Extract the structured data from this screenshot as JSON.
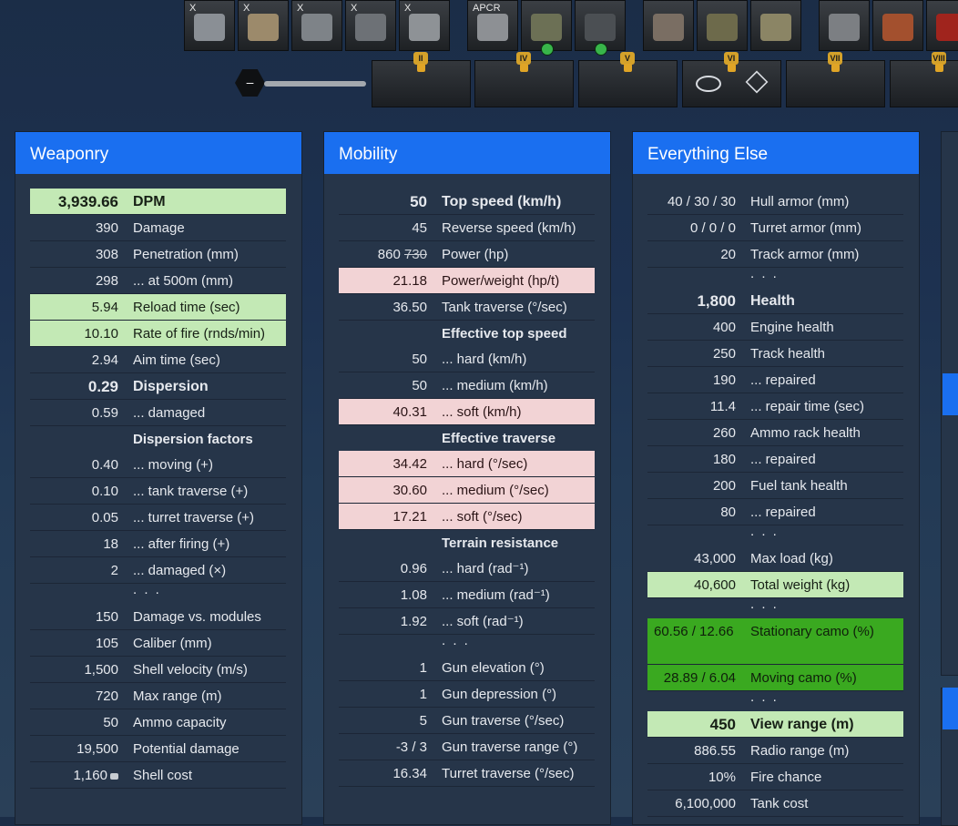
{
  "modules_top": [
    {
      "label": "X",
      "icon": "gun-module-icon",
      "color": "#8a8f95"
    },
    {
      "label": "X",
      "icon": "turret-module-icon",
      "color": "#9c8a6b"
    },
    {
      "label": "X",
      "icon": "engine-module-icon",
      "color": "#7e8388"
    },
    {
      "label": "X",
      "icon": "tracks-module-icon",
      "color": "#6d7176"
    },
    {
      "label": "X",
      "icon": "radio-module-icon",
      "color": "#8e9296"
    },
    {
      "label": "APCR",
      "icon": "shell-icon",
      "color": "#8d9094"
    },
    {
      "label": "",
      "icon": "ammo-box-icon",
      "color": "#6c7055"
    },
    {
      "label": "",
      "icon": "tank-badge-icon",
      "color": "#4b4f53"
    },
    {
      "label": "",
      "icon": "rammer-icon",
      "color": "#7a6e63"
    },
    {
      "label": "",
      "icon": "camo-net-icon",
      "color": "#6d6a4b"
    },
    {
      "label": "",
      "icon": "vent-icon",
      "color": "#8b8565"
    },
    {
      "label": "",
      "icon": "wheels-icon",
      "color": "#7c7f83"
    },
    {
      "label": "",
      "icon": "medkit-icon",
      "color": "#a3502e"
    },
    {
      "label": "",
      "icon": "extra-slot-icon",
      "color": "#a0241d"
    }
  ],
  "tiers": [
    "II",
    "IV",
    "V",
    "VI",
    "VII",
    "VIII"
  ],
  "slider": {
    "knob_label": "–"
  },
  "weaponry": {
    "title": "Weaponry",
    "rows": [
      {
        "v": "3,939.66",
        "l": "DPM",
        "style": "bold green"
      },
      {
        "v": "390",
        "l": "Damage"
      },
      {
        "v": "308",
        "l": "Penetration (mm)"
      },
      {
        "v": "298",
        "l": "... at 500m (mm)"
      },
      {
        "v": "5.94",
        "l": "Reload time (sec)",
        "style": "green"
      },
      {
        "v": "10.10",
        "l": "Rate of fire (rnds/min)",
        "style": "green"
      },
      {
        "v": "2.94",
        "l": "Aim time (sec)"
      },
      {
        "v": "0.29",
        "l": "Dispersion",
        "style": "bold"
      },
      {
        "v": "0.59",
        "l": "... damaged"
      },
      {
        "v": "",
        "l": "Dispersion factors",
        "style": "head"
      },
      {
        "v": "0.40",
        "l": "... moving (+)"
      },
      {
        "v": "0.10",
        "l": "... tank traverse (+)"
      },
      {
        "v": "0.05",
        "l": "... turret traverse (+)"
      },
      {
        "v": "18",
        "l": "... after firing (+)"
      },
      {
        "v": "2",
        "l": "... damaged (×)"
      },
      {
        "v": "",
        "l": ". . .",
        "style": "dots"
      },
      {
        "v": "150",
        "l": "Damage vs. modules"
      },
      {
        "v": "105",
        "l": "Caliber (mm)"
      },
      {
        "v": "1,500",
        "l": "Shell velocity (m/s)"
      },
      {
        "v": "720",
        "l": "Max range (m)"
      },
      {
        "v": "50",
        "l": "Ammo capacity"
      },
      {
        "v": "19,500",
        "l": "Potential damage"
      },
      {
        "v": "1,160",
        "l": "Shell cost",
        "style": "coin"
      }
    ]
  },
  "mobility": {
    "title": "Mobility",
    "power_old": "730",
    "rows": [
      {
        "v": "50",
        "l": "Top speed (km/h)",
        "style": "bold"
      },
      {
        "v": "45",
        "l": "Reverse speed (km/h)"
      },
      {
        "v": "860",
        "l": "Power (hp)",
        "style": "strike"
      },
      {
        "v": "21.18",
        "l": "Power/weight (hp/t)",
        "style": "red"
      },
      {
        "v": "36.50",
        "l": "Tank traverse (°/sec)"
      },
      {
        "v": "",
        "l": "Effective top speed",
        "style": "head"
      },
      {
        "v": "50",
        "l": "... hard (km/h)"
      },
      {
        "v": "50",
        "l": "... medium (km/h)"
      },
      {
        "v": "40.31",
        "l": "... soft (km/h)",
        "style": "red"
      },
      {
        "v": "",
        "l": "Effective traverse",
        "style": "head"
      },
      {
        "v": "34.42",
        "l": "... hard (°/sec)",
        "style": "red"
      },
      {
        "v": "30.60",
        "l": "... medium (°/sec)",
        "style": "red"
      },
      {
        "v": "17.21",
        "l": "... soft (°/sec)",
        "style": "red"
      },
      {
        "v": "",
        "l": "Terrain resistance",
        "style": "head"
      },
      {
        "v": "0.96",
        "l": "... hard (rad⁻¹)"
      },
      {
        "v": "1.08",
        "l": "... medium (rad⁻¹)"
      },
      {
        "v": "1.92",
        "l": "... soft (rad⁻¹)"
      },
      {
        "v": "",
        "l": ". . .",
        "style": "dots"
      },
      {
        "v": "1",
        "l": "Gun elevation (°)"
      },
      {
        "v": "1",
        "l": "Gun depression (°)"
      },
      {
        "v": "5",
        "l": "Gun traverse (°/sec)"
      },
      {
        "v": "-3 / 3",
        "l": "Gun traverse range (°)"
      },
      {
        "v": "16.34",
        "l": "Turret traverse (°/sec)"
      }
    ]
  },
  "everything": {
    "title": "Everything Else",
    "rows": [
      {
        "v": "40 / 30 / 30",
        "l": "Hull armor (mm)"
      },
      {
        "v": "0 / 0 / 0",
        "l": "Turret armor (mm)"
      },
      {
        "v": "20",
        "l": "Track armor (mm)"
      },
      {
        "v": "",
        "l": ". . .",
        "style": "dots"
      },
      {
        "v": "1,800",
        "l": "Health",
        "style": "bold"
      },
      {
        "v": "400",
        "l": "Engine health"
      },
      {
        "v": "250",
        "l": "Track health"
      },
      {
        "v": "190",
        "l": "... repaired"
      },
      {
        "v": "11.4",
        "l": "... repair time (sec)"
      },
      {
        "v": "260",
        "l": "Ammo rack health"
      },
      {
        "v": "180",
        "l": "... repaired"
      },
      {
        "v": "200",
        "l": "Fuel tank health"
      },
      {
        "v": "80",
        "l": "... repaired"
      },
      {
        "v": "",
        "l": ". . .",
        "style": "dots"
      },
      {
        "v": "43,000",
        "l": "Max load (kg)"
      },
      {
        "v": "40,600",
        "l": "Total weight (kg)",
        "style": "green"
      },
      {
        "v": "",
        "l": ". . .",
        "style": "dots"
      },
      {
        "v": "60.56 / 12.66",
        "l": "Stationary camo (%)",
        "style": "dark2"
      },
      {
        "v": "28.89 / 6.04",
        "l": "Moving camo (%)",
        "style": "dark"
      },
      {
        "v": "",
        "l": ". . .",
        "style": "dots"
      },
      {
        "v": "450",
        "l": "View range (m)",
        "style": "bold green"
      },
      {
        "v": "886.55",
        "l": "Radio range (m)"
      },
      {
        "v": "10%",
        "l": "Fire chance"
      },
      {
        "v": "6,100,000",
        "l": "Tank cost"
      }
    ]
  }
}
